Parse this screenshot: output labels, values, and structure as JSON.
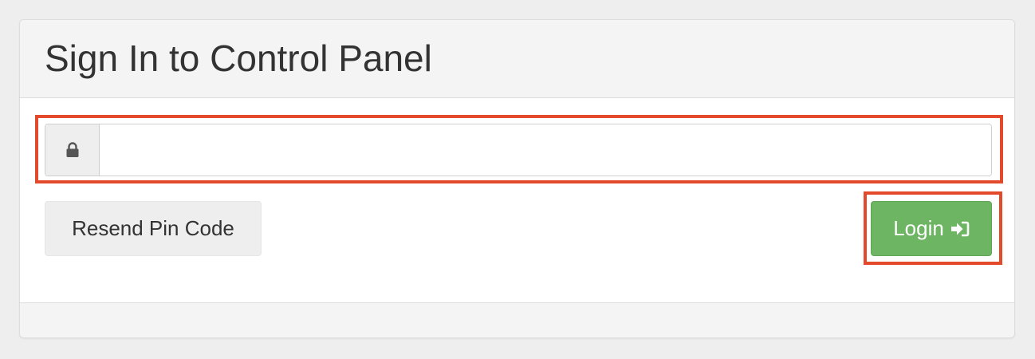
{
  "panel": {
    "title": "Sign In to Control Panel"
  },
  "pin_field": {
    "value": "",
    "placeholder": "",
    "addon_icon": "lock-icon"
  },
  "buttons": {
    "resend_label": "Resend Pin Code",
    "login_label": "Login",
    "login_icon": "sign-in-icon"
  },
  "colors": {
    "login_button": "#6db563",
    "highlight": "#e24a2b",
    "panel_header": "#f4f4f4"
  }
}
